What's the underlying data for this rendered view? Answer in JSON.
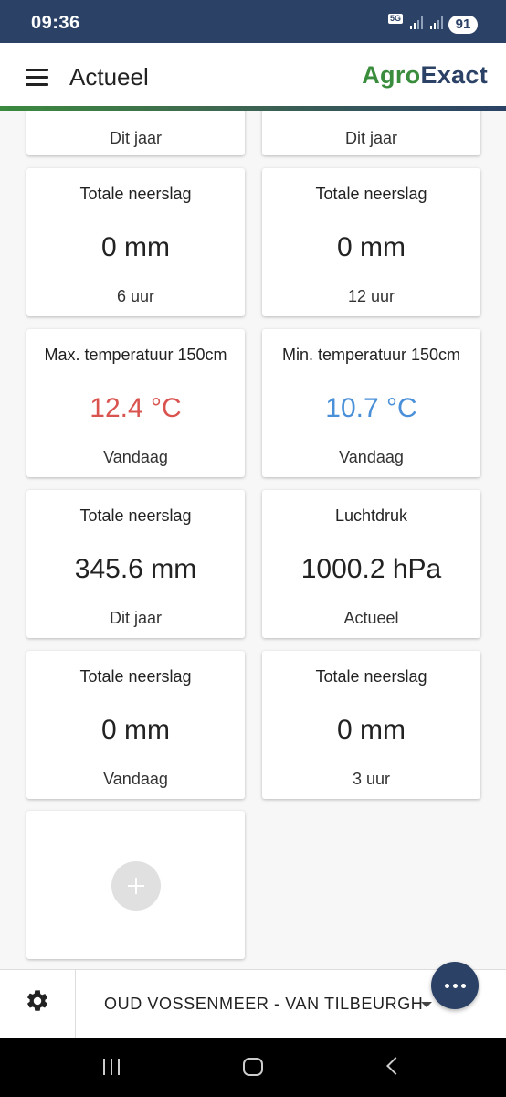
{
  "status_bar": {
    "time": "09:36",
    "network": "5G",
    "battery": "91"
  },
  "app_bar": {
    "title": "Actueel",
    "brand_part1": "Agro",
    "brand_part2": "Exact"
  },
  "cards": [
    {
      "title": "",
      "value": "",
      "sub": "Dit jaar"
    },
    {
      "title": "",
      "value": "",
      "sub": "Dit jaar"
    },
    {
      "title": "Totale neerslag",
      "value": "0 mm",
      "sub": "6 uur",
      "value_color": "#222222"
    },
    {
      "title": "Totale neerslag",
      "value": "0 mm",
      "sub": "12 uur",
      "value_color": "#222222"
    },
    {
      "title": "Max. temperatuur 150cm",
      "value": "12.4 °C",
      "sub": "Vandaag",
      "value_color": "#d9534f"
    },
    {
      "title": "Min. temperatuur 150cm",
      "value": "10.7 °C",
      "sub": "Vandaag",
      "value_color": "#4a90d9"
    },
    {
      "title": "Totale neerslag",
      "value": "345.6 mm",
      "sub": "Dit jaar",
      "value_color": "#222222"
    },
    {
      "title": "Luchtdruk",
      "value": "1000.2 hPa",
      "sub": "Actueel",
      "value_color": "#222222"
    },
    {
      "title": "Totale neerslag",
      "value": "0 mm",
      "sub": "Vandaag",
      "value_color": "#222222"
    },
    {
      "title": "Totale neerslag",
      "value": "0 mm",
      "sub": "3 uur",
      "value_color": "#222222"
    }
  ],
  "add_card": {
    "icon": "plus-icon"
  },
  "bottom_bar": {
    "settings_icon": "gear-icon",
    "location": "OUD VOSSENMEER - VAN TILBEURGH"
  },
  "fab": {
    "icon": "more-horizontal-icon"
  }
}
